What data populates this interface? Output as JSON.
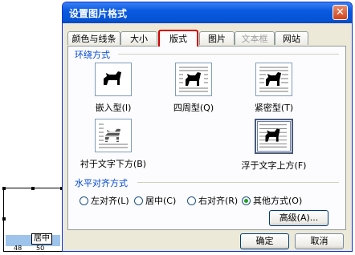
{
  "thumbnail": {
    "caption": "居中",
    "left_num": "48",
    "right_num": "50"
  },
  "dialog": {
    "title": "设置图片格式",
    "close_symbol": "✕",
    "tabs": [
      {
        "label": "颜色与线条",
        "state": "normal"
      },
      {
        "label": "大小",
        "state": "normal"
      },
      {
        "label": "版式",
        "state": "active"
      },
      {
        "label": "图片",
        "state": "normal"
      },
      {
        "label": "文本框",
        "state": "disabled"
      },
      {
        "label": "网站",
        "state": "normal"
      }
    ],
    "wrap_section": {
      "label": "环绕方式",
      "options": [
        {
          "label": "嵌入型(I)",
          "icon": "inline-dog-icon"
        },
        {
          "label": "四周型(Q)",
          "icon": "square-dog-icon"
        },
        {
          "label": "紧密型(T)",
          "icon": "tight-dog-icon"
        },
        {
          "label": "衬于文字下方(B)",
          "icon": "behind-text-dog-icon"
        },
        {
          "label": "浮于文字上方(F)",
          "icon": "in-front-text-dog-icon",
          "selected": true
        }
      ]
    },
    "align_section": {
      "label": "水平对齐方式",
      "options": [
        {
          "label": "左对齐(L)",
          "checked": false
        },
        {
          "label": "居中(C)",
          "checked": false
        },
        {
          "label": "右对齐(R)",
          "checked": false
        },
        {
          "label": "其他方式(O)",
          "checked": true
        }
      ],
      "advanced_label": "高级(A)..."
    },
    "ok_label": "确定",
    "cancel_label": "取消"
  },
  "colors": {
    "titlebar": "#0553d5",
    "group_label": "#0046d5",
    "active_tab_highlight": "#cc0000"
  }
}
